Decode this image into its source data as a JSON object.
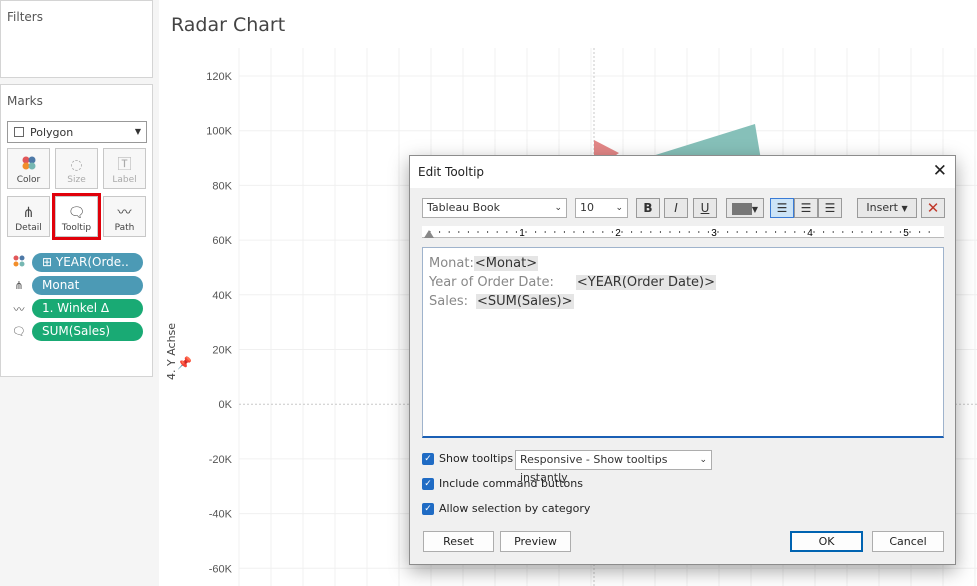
{
  "filters": {
    "title": "Filters"
  },
  "marks": {
    "title": "Marks",
    "mark_type": "Polygon",
    "cards": [
      {
        "label": "Color"
      },
      {
        "label": "Size"
      },
      {
        "label": "Label"
      },
      {
        "label": "Detail"
      },
      {
        "label": "Tooltip"
      },
      {
        "label": "Path"
      }
    ],
    "pills": [
      {
        "text": "⊞ YEAR(Orde.."
      },
      {
        "text": "Monat"
      },
      {
        "text": "1. Winkel        Δ"
      },
      {
        "text": "SUM(Sales)"
      }
    ]
  },
  "chart": {
    "title": "Radar Chart",
    "yaxis_title": "4. Y Achse",
    "ticks": [
      "120K",
      "100K",
      "80K",
      "60K",
      "40K",
      "20K",
      "0K",
      "-20K",
      "-40K",
      "-60K"
    ],
    "colors": {
      "red": "#e07a7a",
      "teal": "#7fbdb5"
    }
  },
  "dialog": {
    "title": "Edit Tooltip",
    "font": "Tableau Book",
    "size": "10",
    "bold": "B",
    "italic": "I",
    "underline": "U",
    "insert": "Insert",
    "ruler": [
      "1",
      "2",
      "3",
      "4",
      "5"
    ],
    "tooltip_lines": [
      {
        "label": "Monat:",
        "field": "<Monat>"
      },
      {
        "label": "Year of Order Date:",
        "field": "<YEAR(Order Date)>"
      },
      {
        "label": "Sales:",
        "field": "<SUM(Sales)>"
      }
    ],
    "show_tooltips": "Show tooltips",
    "tooltip_mode": "Responsive - Show tooltips instantly",
    "include_cmd": "Include command buttons",
    "allow_sel": "Allow selection by category",
    "reset": "Reset",
    "preview": "Preview",
    "ok": "OK",
    "cancel": "Cancel"
  }
}
